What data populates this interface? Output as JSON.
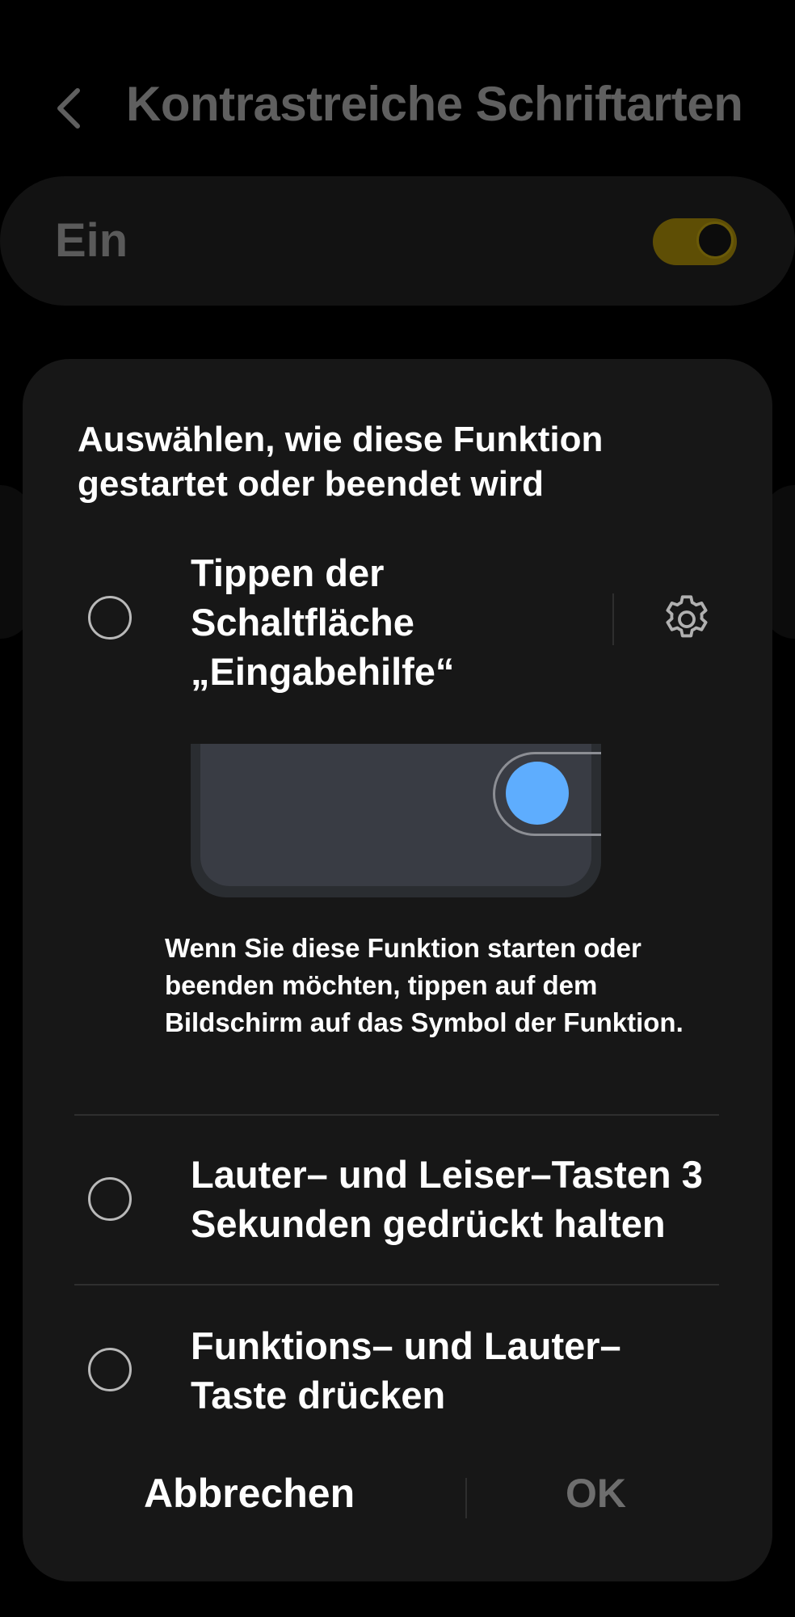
{
  "header": {
    "title": "Kontrastreiche Schriftarten",
    "back_icon": "chevron-left-icon"
  },
  "main_switch": {
    "label": "Ein",
    "on": true,
    "track_color": "#5e4e05"
  },
  "dialog": {
    "title": "Auswählen, wie diese Funktion gestartet oder beendet wird",
    "options": [
      {
        "label": "Tippen der Schaltfläche „Eingabehilfe“",
        "selected": false,
        "settings_icon": "gear-icon",
        "description": "Wenn Sie diese Funktion starten oder beenden möchten, tippen auf dem Bildschirm auf das Symbol der Funktion."
      },
      {
        "label": "Lauter– und Leiser–Tasten 3 Sekunden gedrückt halten",
        "selected": false
      },
      {
        "label": "Funktions– und Lauter–Taste drücken",
        "selected": false
      }
    ],
    "cancel_label": "Abbrechen",
    "ok_label": "OK",
    "preview_dot_color": "#5eadfe"
  }
}
